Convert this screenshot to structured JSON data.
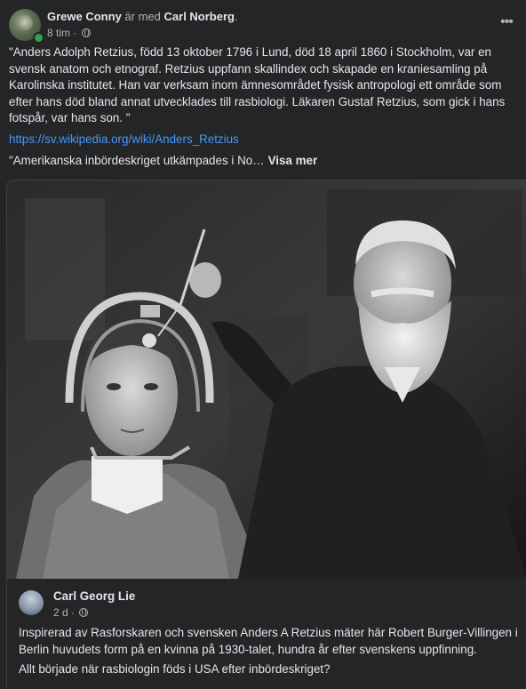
{
  "post": {
    "author": "Grewe Conny",
    "with_word": "är med",
    "tagged": "Carl Norberg",
    "period": ".",
    "time": "8 tim",
    "dot": "·",
    "menu": "•••",
    "text": "\"Anders Adolph Retzius, född 13 oktober 1796 i Lund, död 18 april 1860 i Stockholm, var en svensk anatom och etnograf. Retzius uppfann skallindex och skapade en kraniesamling på Karolinska institutet. Han var verksam inom ämnesområdet fysisk antropologi ett område som efter hans död bland annat utvecklades till rasbiologi. Läkaren Gustaf Retzius, som gick i hans fotspår, var hans son. \"",
    "link": "https://sv.wikipedia.org/wiki/Anders_Retzius",
    "snippet": "\"Amerikanska inbördeskriget utkämpades i No…",
    "see_more": "Visa mer"
  },
  "shared": {
    "author": "Carl Georg Lie",
    "time": "2 d",
    "dot": "·",
    "paragraphs": [
      "Inspirerad av Rasforskaren och svensken Anders A Retzius mäter här Robert Burger-Villingen i Berlin huvudets form på en kvinna på 1930-talet, hundra år efter svenskens uppfinning.",
      "Allt började när rasbiologin föds i USA efter inbördeskriget?"
    ]
  },
  "icons": {
    "privacy": "globe-icon",
    "more": "more-options-icon"
  }
}
